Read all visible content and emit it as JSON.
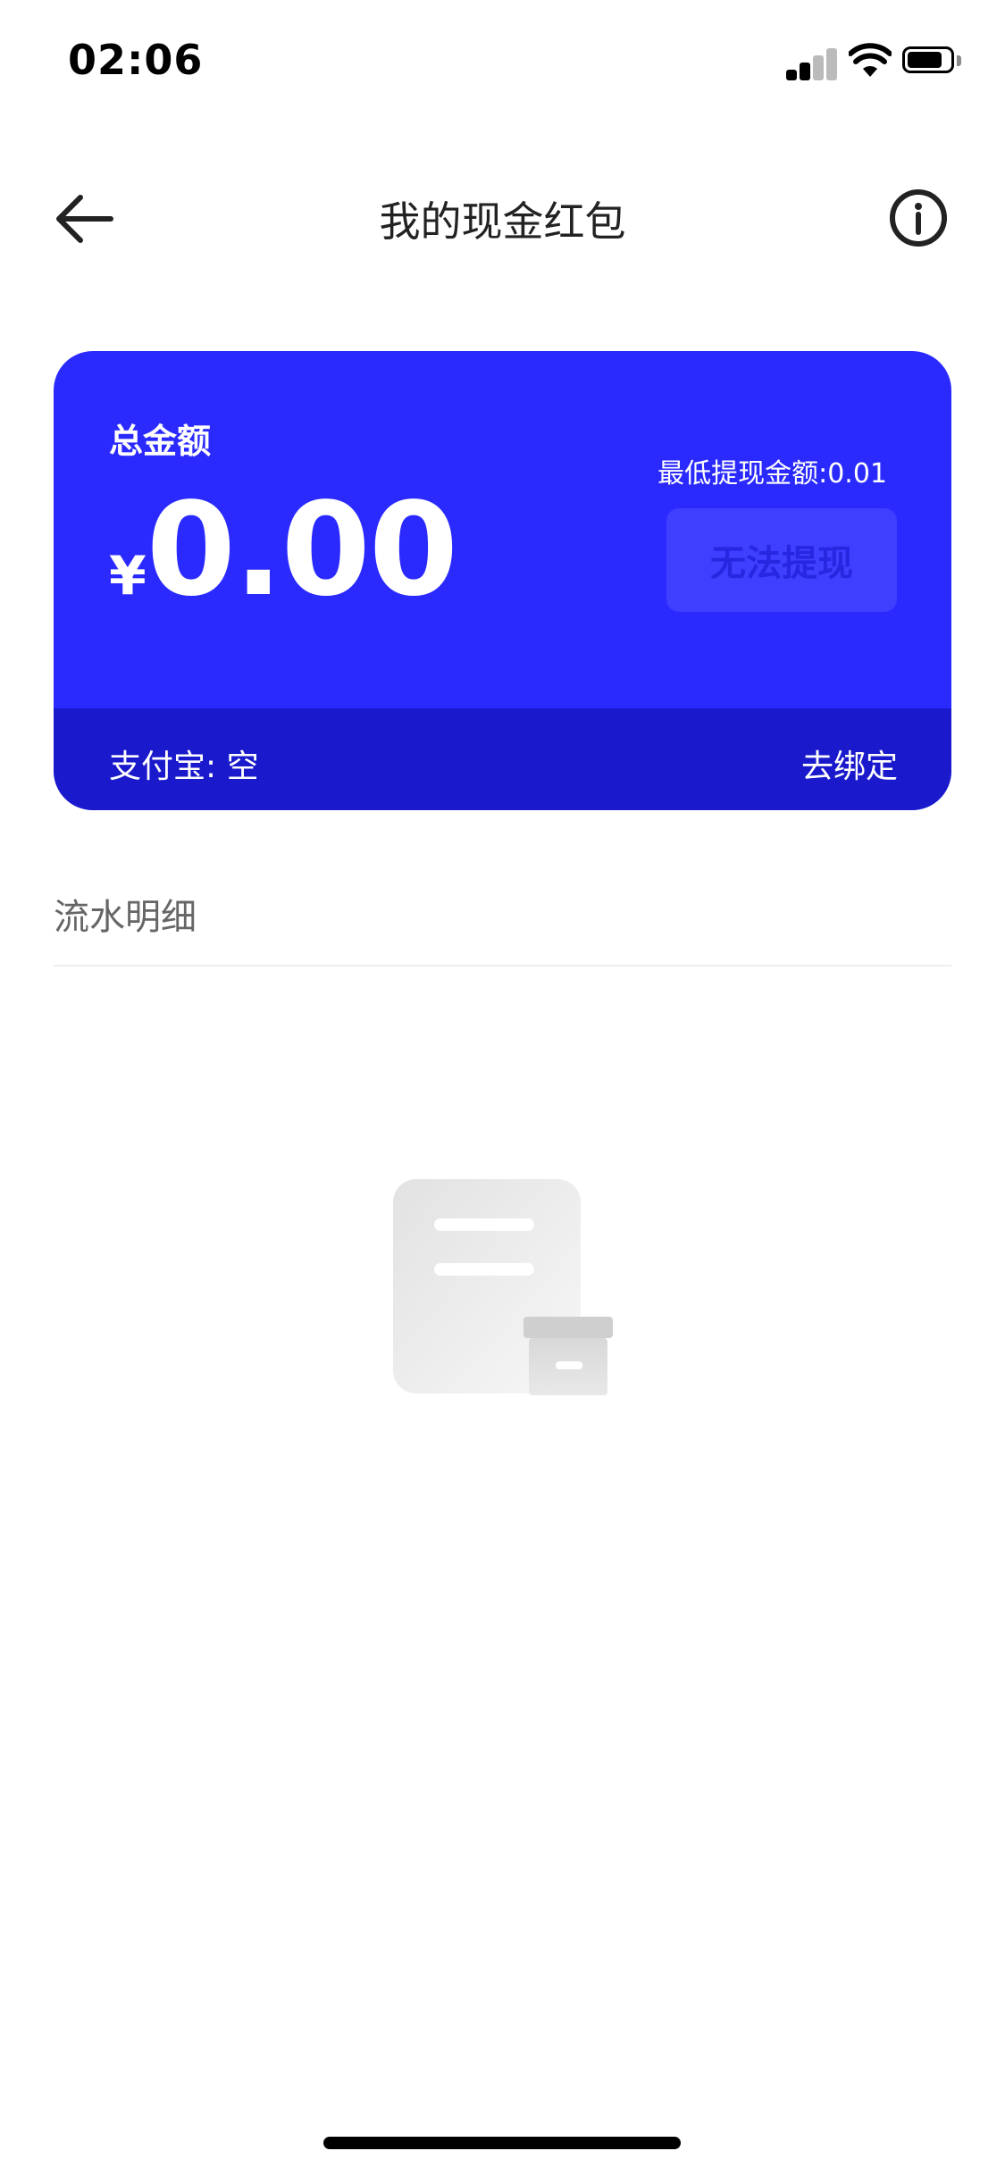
{
  "status_bar": {
    "time": "02:06",
    "icons": [
      "signal-icon",
      "wifi-icon",
      "battery-icon"
    ]
  },
  "nav": {
    "title": "我的现金红包",
    "back_icon": "arrow-left-icon",
    "info_icon": "info-icon"
  },
  "card": {
    "label": "总金额",
    "currency": "¥",
    "amount": "0.00",
    "min_withdraw": "最低提现金额:0.01",
    "withdraw_button": "无法提现",
    "alipay": "支付宝: 空",
    "bind_link": "去绑定"
  },
  "details": {
    "title": "流水明细"
  },
  "empty_state": {
    "icon": "empty-document-icon"
  },
  "colors": {
    "card": "#2a2aff",
    "card_footer": "#1a1acc"
  }
}
